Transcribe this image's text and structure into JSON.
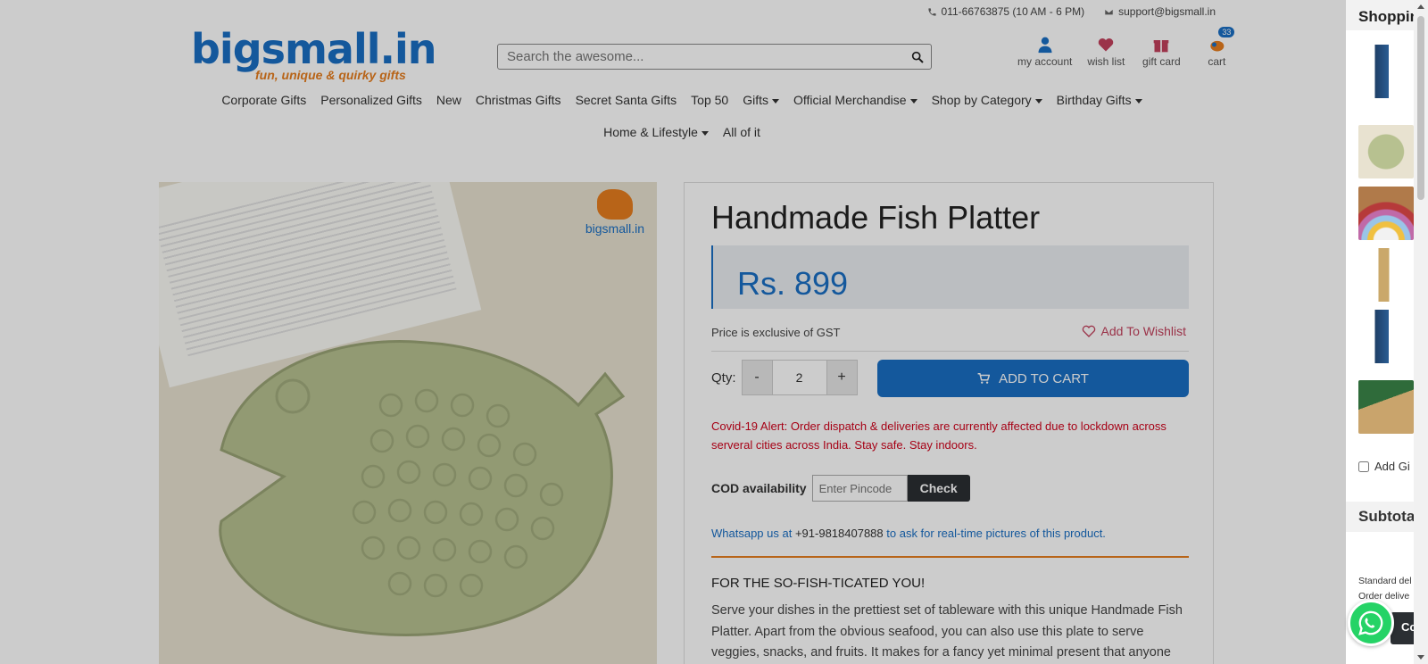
{
  "topbar": {
    "phone": "011-66763875 (10 AM - 6 PM)",
    "email": "support@bigsmall.in"
  },
  "logo": {
    "brand": "bigsmall.in",
    "tagline": "fun, unique & quirky gifts"
  },
  "search": {
    "placeholder": "Search the awesome..."
  },
  "header_icons": {
    "account": "my account",
    "wishlist": "wish list",
    "giftcard": "gift card",
    "cart": "cart",
    "cart_count": "33"
  },
  "nav": {
    "row1": [
      "Corporate Gifts",
      "Personalized Gifts",
      "New",
      "Christmas Gifts",
      "Secret Santa Gifts",
      "Top 50",
      "Gifts",
      "Official Merchandise",
      "Shop by Category",
      "Birthday Gifts"
    ],
    "row2": [
      "Home & Lifestyle",
      "All of it"
    ]
  },
  "image_watermark": "bigsmall.in",
  "product": {
    "title": "Handmade Fish Platter",
    "price": "Rs. 899",
    "gst_note": "Price is exclusive of GST",
    "wishlist": "Add To Wishlist",
    "qty_label": "Qty:",
    "qty_minus": "-",
    "qty_value": "2",
    "qty_plus": "+",
    "add_to_cart": "ADD TO CART",
    "covid_alert": "Covid-19 Alert: Order dispatch & deliveries are currently affected due to lockdown across serveral cities across India. Stay safe. Stay indoors.",
    "cod_label": "COD availability",
    "pincode_placeholder": "Enter Pincode",
    "check": "Check",
    "whatsapp_pre": "Whatsapp us at",
    "whatsapp_number": "+91-9818407888",
    "whatsapp_post": "to ask for real-time pictures of this product.",
    "subheading": "FOR THE SO-FISH-TICATED YOU!",
    "description": "Serve your dishes in the prettiest set of tableware with this unique Handmade Fish Platter. Apart from the obvious seafood, you can also use this plate to serve veggies, snacks, and fruits. It makes for a fancy yet minimal present that anyone"
  },
  "drawer": {
    "title": "Shoppin",
    "gift_label": "Add Gi",
    "subtotal": "Subtota",
    "ship1": "Standard del",
    "ship2": "Order delive",
    "checkout": "Co"
  },
  "colors": {
    "brand_blue": "#1a6fc4",
    "brand_orange": "#e67e1f",
    "alert_red": "#d0021b",
    "whatsapp_green": "#25d366"
  }
}
